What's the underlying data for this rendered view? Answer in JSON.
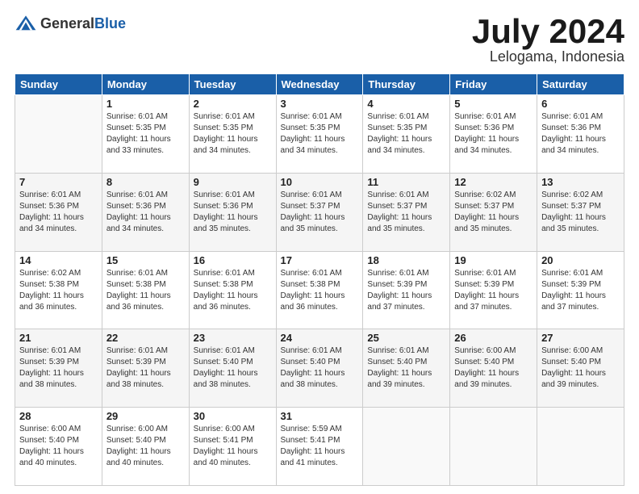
{
  "header": {
    "logo_general": "General",
    "logo_blue": "Blue",
    "month_title": "July 2024",
    "location": "Lelogama, Indonesia"
  },
  "columns": [
    "Sunday",
    "Monday",
    "Tuesday",
    "Wednesday",
    "Thursday",
    "Friday",
    "Saturday"
  ],
  "weeks": [
    [
      {
        "day": "",
        "info": ""
      },
      {
        "day": "1",
        "info": "Sunrise: 6:01 AM\nSunset: 5:35 PM\nDaylight: 11 hours\nand 33 minutes."
      },
      {
        "day": "2",
        "info": "Sunrise: 6:01 AM\nSunset: 5:35 PM\nDaylight: 11 hours\nand 34 minutes."
      },
      {
        "day": "3",
        "info": "Sunrise: 6:01 AM\nSunset: 5:35 PM\nDaylight: 11 hours\nand 34 minutes."
      },
      {
        "day": "4",
        "info": "Sunrise: 6:01 AM\nSunset: 5:35 PM\nDaylight: 11 hours\nand 34 minutes."
      },
      {
        "day": "5",
        "info": "Sunrise: 6:01 AM\nSunset: 5:36 PM\nDaylight: 11 hours\nand 34 minutes."
      },
      {
        "day": "6",
        "info": "Sunrise: 6:01 AM\nSunset: 5:36 PM\nDaylight: 11 hours\nand 34 minutes."
      }
    ],
    [
      {
        "day": "7",
        "info": "Sunrise: 6:01 AM\nSunset: 5:36 PM\nDaylight: 11 hours\nand 34 minutes."
      },
      {
        "day": "8",
        "info": "Sunrise: 6:01 AM\nSunset: 5:36 PM\nDaylight: 11 hours\nand 34 minutes."
      },
      {
        "day": "9",
        "info": "Sunrise: 6:01 AM\nSunset: 5:36 PM\nDaylight: 11 hours\nand 35 minutes."
      },
      {
        "day": "10",
        "info": "Sunrise: 6:01 AM\nSunset: 5:37 PM\nDaylight: 11 hours\nand 35 minutes."
      },
      {
        "day": "11",
        "info": "Sunrise: 6:01 AM\nSunset: 5:37 PM\nDaylight: 11 hours\nand 35 minutes."
      },
      {
        "day": "12",
        "info": "Sunrise: 6:02 AM\nSunset: 5:37 PM\nDaylight: 11 hours\nand 35 minutes."
      },
      {
        "day": "13",
        "info": "Sunrise: 6:02 AM\nSunset: 5:37 PM\nDaylight: 11 hours\nand 35 minutes."
      }
    ],
    [
      {
        "day": "14",
        "info": "Sunrise: 6:02 AM\nSunset: 5:38 PM\nDaylight: 11 hours\nand 36 minutes."
      },
      {
        "day": "15",
        "info": "Sunrise: 6:01 AM\nSunset: 5:38 PM\nDaylight: 11 hours\nand 36 minutes."
      },
      {
        "day": "16",
        "info": "Sunrise: 6:01 AM\nSunset: 5:38 PM\nDaylight: 11 hours\nand 36 minutes."
      },
      {
        "day": "17",
        "info": "Sunrise: 6:01 AM\nSunset: 5:38 PM\nDaylight: 11 hours\nand 36 minutes."
      },
      {
        "day": "18",
        "info": "Sunrise: 6:01 AM\nSunset: 5:39 PM\nDaylight: 11 hours\nand 37 minutes."
      },
      {
        "day": "19",
        "info": "Sunrise: 6:01 AM\nSunset: 5:39 PM\nDaylight: 11 hours\nand 37 minutes."
      },
      {
        "day": "20",
        "info": "Sunrise: 6:01 AM\nSunset: 5:39 PM\nDaylight: 11 hours\nand 37 minutes."
      }
    ],
    [
      {
        "day": "21",
        "info": "Sunrise: 6:01 AM\nSunset: 5:39 PM\nDaylight: 11 hours\nand 38 minutes."
      },
      {
        "day": "22",
        "info": "Sunrise: 6:01 AM\nSunset: 5:39 PM\nDaylight: 11 hours\nand 38 minutes."
      },
      {
        "day": "23",
        "info": "Sunrise: 6:01 AM\nSunset: 5:40 PM\nDaylight: 11 hours\nand 38 minutes."
      },
      {
        "day": "24",
        "info": "Sunrise: 6:01 AM\nSunset: 5:40 PM\nDaylight: 11 hours\nand 38 minutes."
      },
      {
        "day": "25",
        "info": "Sunrise: 6:01 AM\nSunset: 5:40 PM\nDaylight: 11 hours\nand 39 minutes."
      },
      {
        "day": "26",
        "info": "Sunrise: 6:00 AM\nSunset: 5:40 PM\nDaylight: 11 hours\nand 39 minutes."
      },
      {
        "day": "27",
        "info": "Sunrise: 6:00 AM\nSunset: 5:40 PM\nDaylight: 11 hours\nand 39 minutes."
      }
    ],
    [
      {
        "day": "28",
        "info": "Sunrise: 6:00 AM\nSunset: 5:40 PM\nDaylight: 11 hours\nand 40 minutes."
      },
      {
        "day": "29",
        "info": "Sunrise: 6:00 AM\nSunset: 5:40 PM\nDaylight: 11 hours\nand 40 minutes."
      },
      {
        "day": "30",
        "info": "Sunrise: 6:00 AM\nSunset: 5:41 PM\nDaylight: 11 hours\nand 40 minutes."
      },
      {
        "day": "31",
        "info": "Sunrise: 5:59 AM\nSunset: 5:41 PM\nDaylight: 11 hours\nand 41 minutes."
      },
      {
        "day": "",
        "info": ""
      },
      {
        "day": "",
        "info": ""
      },
      {
        "day": "",
        "info": ""
      }
    ]
  ]
}
